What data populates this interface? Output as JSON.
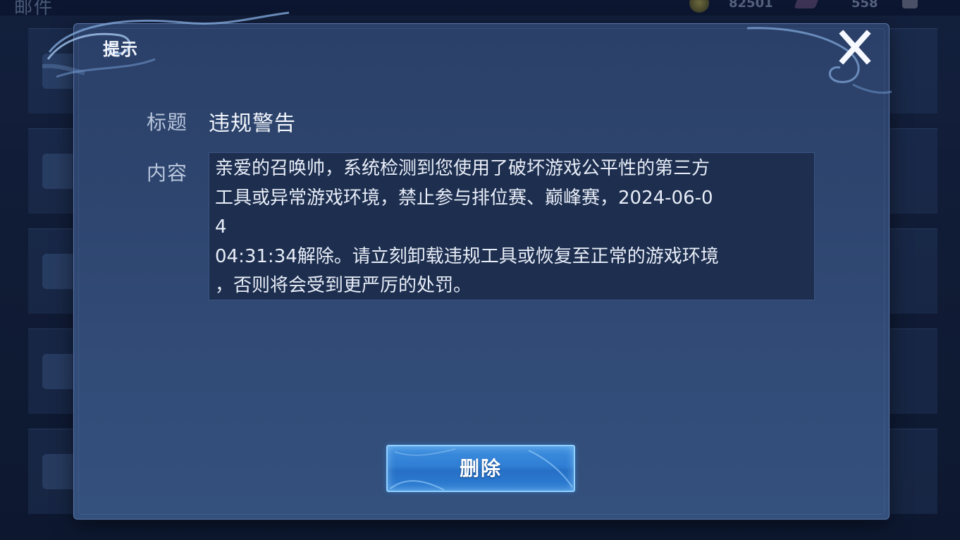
{
  "background": {
    "title": "邮件",
    "currency_gold": "82501",
    "currency_gem": "558"
  },
  "dialog": {
    "title": "提示",
    "close_icon": "close-x-icon",
    "subject_label": "标题",
    "subject_value": "违规警告",
    "content_label": "内容",
    "content_text": "亲爱的召唤帅，系统检测到您使用了破坏游戏公平性的第三方\n工具或异常游戏环境，禁止参与排位赛、巅峰赛，2024-06-0\n4\n04:31:34解除。请立刻卸载违规工具或恢复至正常的游戏环境\n，否则将会受到更严厉的处罚。",
    "delete_button_label": "删除"
  },
  "colors": {
    "dialog_bg": "#2e4670",
    "button_blue": "#2f7ed4",
    "button_border": "#8fd0ff",
    "text_primary": "#f2f5fb",
    "label_text": "#b9c6dc"
  }
}
